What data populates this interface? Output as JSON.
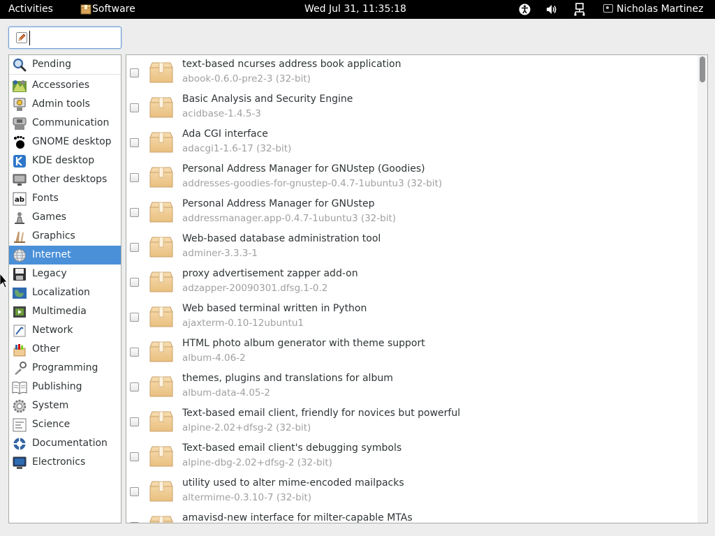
{
  "topbar": {
    "activities": "Activities",
    "app_name": "Software",
    "clock": "Wed Jul 31, 11:35:18",
    "user": "Nicholas Martinez",
    "icons": [
      "accessibility-icon",
      "volume-icon",
      "network-icon"
    ]
  },
  "search": {
    "value": "",
    "icon": "edit-clear-icon"
  },
  "categories": [
    {
      "label": "Pending",
      "icon": "search-icon"
    },
    {
      "label": "Accessories",
      "icon": "accessories-icon"
    },
    {
      "label": "Admin tools",
      "icon": "admin-tools-icon"
    },
    {
      "label": "Communication",
      "icon": "communication-icon"
    },
    {
      "label": "GNOME desktop",
      "icon": "gnome-foot-icon"
    },
    {
      "label": "KDE desktop",
      "icon": "kde-icon"
    },
    {
      "label": "Other desktops",
      "icon": "other-desktops-icon"
    },
    {
      "label": "Fonts",
      "icon": "fonts-icon"
    },
    {
      "label": "Games",
      "icon": "games-icon"
    },
    {
      "label": "Graphics",
      "icon": "graphics-icon"
    },
    {
      "label": "Internet",
      "icon": "globe-icon",
      "selected": true
    },
    {
      "label": "Legacy",
      "icon": "floppy-icon"
    },
    {
      "label": "Localization",
      "icon": "localization-icon"
    },
    {
      "label": "Multimedia",
      "icon": "multimedia-icon"
    },
    {
      "label": "Network",
      "icon": "network-tools-icon"
    },
    {
      "label": "Other",
      "icon": "other-icon"
    },
    {
      "label": "Programming",
      "icon": "programming-icon"
    },
    {
      "label": "Publishing",
      "icon": "publishing-icon"
    },
    {
      "label": "System",
      "icon": "system-icon"
    },
    {
      "label": "Science",
      "icon": "science-icon"
    },
    {
      "label": "Documentation",
      "icon": "documentation-icon"
    },
    {
      "label": "Electronics",
      "icon": "electronics-icon"
    }
  ],
  "packages": [
    {
      "title": "text-based ncurses address book application",
      "name": "abook-0.6.0-pre2-3 (32-bit)",
      "checked": false
    },
    {
      "title": "Basic Analysis and Security Engine",
      "name": "acidbase-1.4.5-3",
      "checked": false
    },
    {
      "title": "Ada CGI interface",
      "name": "adacgi1-1.6-17 (32-bit)",
      "checked": false
    },
    {
      "title": "Personal Address Manager for GNUstep (Goodies)",
      "name": "addresses-goodies-for-gnustep-0.4.7-1ubuntu3 (32-bit)",
      "checked": false
    },
    {
      "title": "Personal Address Manager for GNUstep",
      "name": "addressmanager.app-0.4.7-1ubuntu3 (32-bit)",
      "checked": false
    },
    {
      "title": "Web-based database administration tool",
      "name": "adminer-3.3.3-1",
      "checked": false
    },
    {
      "title": "proxy advertisement zapper add-on",
      "name": "adzapper-20090301.dfsg.1-0.2",
      "checked": false
    },
    {
      "title": "Web based terminal written in Python",
      "name": "ajaxterm-0.10-12ubuntu1",
      "checked": false
    },
    {
      "title": "HTML photo album generator with theme support",
      "name": "album-4.06-2",
      "checked": false
    },
    {
      "title": "themes, plugins and translations for album",
      "name": "album-data-4.05-2",
      "checked": false
    },
    {
      "title": "Text-based email client, friendly for novices but powerful",
      "name": "alpine-2.02+dfsg-2 (32-bit)",
      "checked": false
    },
    {
      "title": "Text-based email client's debugging symbols",
      "name": "alpine-dbg-2.02+dfsg-2 (32-bit)",
      "checked": false
    },
    {
      "title": "utility used to alter mime-encoded mailpacks",
      "name": "altermime-0.3.10-7 (32-bit)",
      "checked": false
    },
    {
      "title": "amavisd-new interface for milter-capable MTAs",
      "name": "",
      "checked": false
    }
  ],
  "colors": {
    "topbar_bg": "#000000",
    "selected_bg": "#4a90d9",
    "secondary_text": "#a0a0a0",
    "package_box": "#f2cc95"
  }
}
